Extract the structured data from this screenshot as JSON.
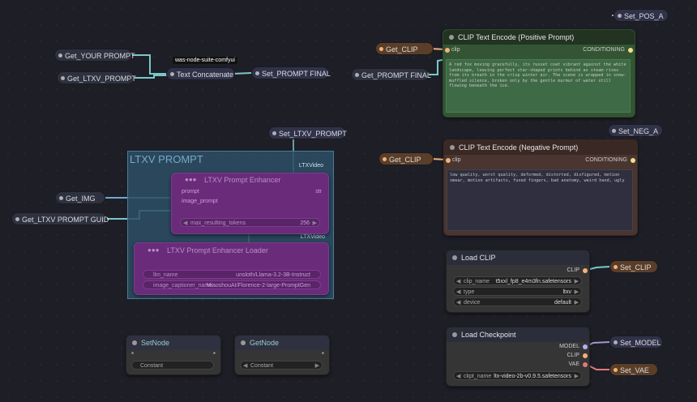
{
  "colors": {
    "background": "#1e1e26",
    "link_cyan": "#79c8c8",
    "link_blue": "#6fa7d6",
    "clip_socket": "#f3b27a",
    "positive_node": "#335533",
    "negative_node": "#4a3530",
    "group_bg": "#2d4f66",
    "purple_node": "#6a2b7a"
  },
  "group": {
    "title": "LTXV PROMPT",
    "label_top": "LTXVideo",
    "label_mid": "LTXVideo"
  },
  "pills": {
    "get_your_prompt": "Get_YOUR PROMPT",
    "get_ltxv_prompt": "Get_LTXV_PROMPT",
    "text_concatenate": "Text Concatenate",
    "set_prompt_final": "Set_PROMPT FINAL",
    "tooltip": "was-node-suite-comfyui",
    "set_ltxv_prompt": "Set_LTXV_PROMPT",
    "get_img": "Get_IMG",
    "get_ltxv_prompt_guid": "Get_LTXV PROMPT GUID",
    "set_pos_a": "Set_POS_A",
    "get_clip_pos": "Get_CLIP",
    "get_prompt_final": "Get_PROMPT FINAL",
    "set_neg_a": "Set_NEG_A",
    "get_clip_neg": "Get_CLIP",
    "set_clip": "Set_CLIP",
    "set_model": "Set_MODEL",
    "set_vae": "Set_VAE"
  },
  "enhancer": {
    "title": "LTXV Prompt Enhancer",
    "inputs": [
      "prompt",
      "image_prompt"
    ],
    "output": "str",
    "widget_label": "max_resulting_tokens",
    "widget_value": "256"
  },
  "enhancer_loader": {
    "title": "LTXV Prompt Enhancer Loader",
    "rows": [
      {
        "label": "llm_name",
        "value": "unsloth/Llama-3.2-3B-Instruct"
      },
      {
        "label": "image_captioner_name",
        "value": "MiaoshouAI/Florence-2-large-PromptGen"
      }
    ]
  },
  "clip_pos": {
    "title": "CLIP Text Encode (Positive Prompt)",
    "input": "clip",
    "output": "CONDITIONING",
    "text": "A red fox moving gracefully, its russet coat vibrant against the white landscape, leaving perfect star-shaped prints behind as steam rises from its breath in the crisp winter air. The scene is wrapped in snow-muffled silence, broken only by the gentle murmur of water still flowing beneath the ice."
  },
  "clip_neg": {
    "title": "CLIP Text Encode (Negative Prompt)",
    "input": "clip",
    "output": "CONDITIONING",
    "text": "low quality, worst quality, deformed, distorted, disfigured, motion smear, motion artifacts, fused fingers, bad anatomy, weird hand, ugly"
  },
  "load_clip": {
    "title": "Load CLIP",
    "output": "CLIP",
    "widgets": [
      {
        "label": "clip_name",
        "value": "t5xxl_fp8_e4m3fn.safetensors"
      },
      {
        "label": "type",
        "value": "ltxv"
      },
      {
        "label": "device",
        "value": "default"
      }
    ]
  },
  "load_checkpoint": {
    "title": "Load Checkpoint",
    "outputs": [
      "MODEL",
      "CLIP",
      "VAE"
    ],
    "widget": {
      "label": "ckpt_name",
      "value": "ltx-video-2b-v0.9.5.safetensors"
    }
  },
  "setnode": {
    "title": "SetNode",
    "in": "*",
    "out": "*",
    "widget": "Constant"
  },
  "getnode": {
    "title": "GetNode",
    "out": "*",
    "widget": "Constant"
  }
}
